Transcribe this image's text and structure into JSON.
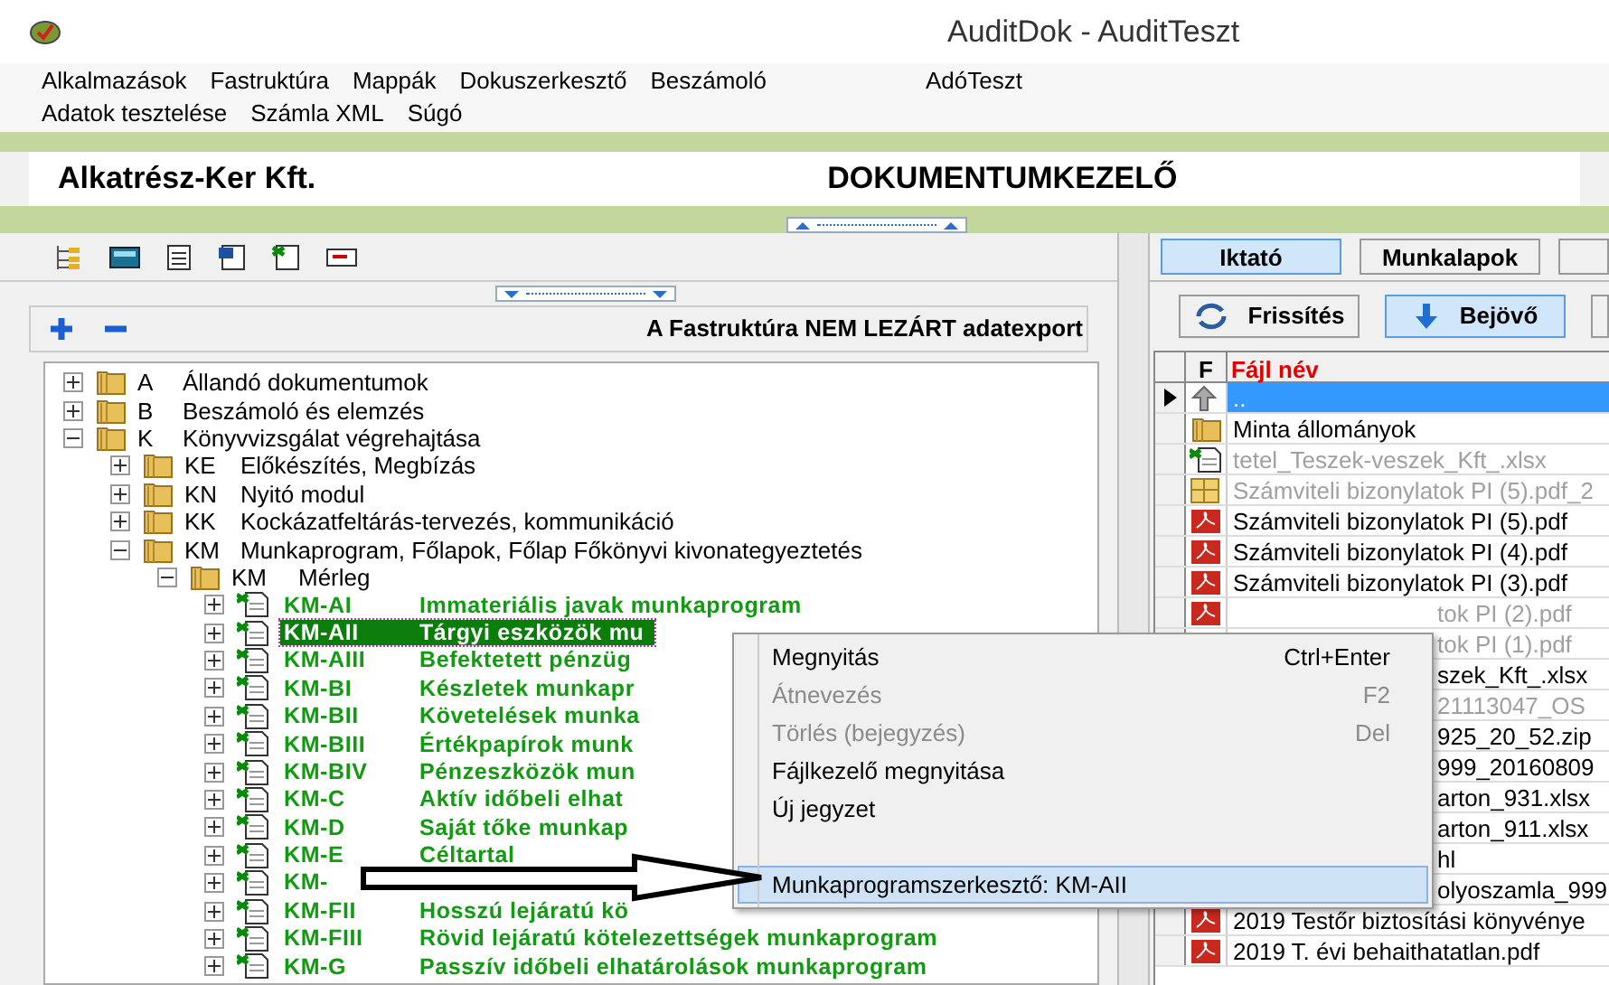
{
  "window": {
    "title": "AuditDok - AuditTeszt"
  },
  "menu_bar": {
    "rows": [
      [
        "Alkalmazások",
        "Fastruktúra",
        "Mappák",
        "Dokuszerkesztő",
        "Beszámoló",
        "AdóTeszt"
      ],
      [
        "Adatok tesztelése",
        "Számla XML",
        "Súgó"
      ]
    ]
  },
  "header": {
    "company": "Alkatrész-Ker Kft.",
    "module": "DOKUMENTUMKEZELŐ"
  },
  "tree_toolbar": {
    "label": "A Fastruktúra NEM LEZÁRT adatexport"
  },
  "tree": [
    {
      "kind": "folder",
      "code": "A",
      "label": "Állandó dokumentumok",
      "expanded": false
    },
    {
      "kind": "folder",
      "code": "B",
      "label": "Beszámoló és elemzés",
      "expanded": false
    },
    {
      "kind": "folder",
      "code": "K",
      "label": "Könyvvizsgálat végrehajtása",
      "expanded": true,
      "children": [
        {
          "kind": "folder",
          "code": "KE",
          "label": "Előkészítés, Megbízás",
          "expanded": false
        },
        {
          "kind": "folder",
          "code": "KN",
          "label": "Nyitó modul",
          "expanded": false
        },
        {
          "kind": "folder",
          "code": "KK",
          "label": "Kockázatfeltárás-tervezés, kommunikáció",
          "expanded": false
        },
        {
          "kind": "folder",
          "code": "KM",
          "label": "Munkaprogram, Főlapok, Főlap Főkönyvi kivonategyeztetés",
          "expanded": true,
          "children": [
            {
              "kind": "folder",
              "code": "KM",
              "label": "Mérleg",
              "expanded": true,
              "children": [
                {
                  "kind": "doc",
                  "code": "KM-AI",
                  "label": "Immateriális javak munkaprogram",
                  "expanded": false,
                  "selected": false
                },
                {
                  "kind": "doc",
                  "code": "KM-AII",
                  "label": "Tárgyi eszközök mu",
                  "expanded": false,
                  "selected": true
                },
                {
                  "kind": "doc",
                  "code": "KM-AIII",
                  "label": "Befektetett pénzüg",
                  "expanded": false,
                  "selected": false
                },
                {
                  "kind": "doc",
                  "code": "KM-BI",
                  "label": "Készletek munkapr",
                  "expanded": false,
                  "selected": false
                },
                {
                  "kind": "doc",
                  "code": "KM-BII",
                  "label": "Követelések munka",
                  "expanded": false,
                  "selected": false
                },
                {
                  "kind": "doc",
                  "code": "KM-BIII",
                  "label": "Értékpapírok munk",
                  "expanded": false,
                  "selected": false
                },
                {
                  "kind": "doc",
                  "code": "KM-BIV",
                  "label": "Pénzeszközök mun",
                  "expanded": false,
                  "selected": false
                },
                {
                  "kind": "doc",
                  "code": "KM-C",
                  "label": "Aktív időbeli elhat",
                  "expanded": false,
                  "selected": false
                },
                {
                  "kind": "doc",
                  "code": "KM-D",
                  "label": "Saját tőke munkap",
                  "expanded": false,
                  "selected": false
                },
                {
                  "kind": "doc",
                  "code": "KM-E",
                  "label": "Céltartal",
                  "expanded": false,
                  "selected": false
                },
                {
                  "kind": "doc",
                  "code": "KM-",
                  "expanded": false,
                  "selected": false
                },
                {
                  "kind": "doc",
                  "code": "KM-FII",
                  "label": "Hosszú lejáratú kö",
                  "expanded": false,
                  "selected": false
                },
                {
                  "kind": "doc",
                  "code": "KM-FIII",
                  "label": "Rövid lejáratú kötelezettségek munkaprogram",
                  "expanded": false,
                  "selected": false
                },
                {
                  "kind": "doc",
                  "code": "KM-G",
                  "label": "Passzív időbeli elhatárolások munkaprogram",
                  "expanded": false,
                  "selected": false
                }
              ]
            }
          ]
        }
      ]
    }
  ],
  "right_tabs": [
    {
      "label": "Iktató",
      "selected": true
    },
    {
      "label": "Munkalapok",
      "selected": false
    }
  ],
  "right_buttons": [
    {
      "kind": "refresh",
      "label": "Frissítés",
      "selected": false
    },
    {
      "kind": "incoming",
      "label": "Bejövő",
      "selected": true
    }
  ],
  "file_grid": {
    "columns": [
      "F",
      "Fájl név"
    ],
    "rows": [
      {
        "kind": "up",
        "name": "..",
        "dimmed": false,
        "selected": true,
        "covered": false
      },
      {
        "kind": "folder",
        "name": "Minta állományok",
        "dimmed": false,
        "selected": false,
        "covered": false
      },
      {
        "kind": "excel",
        "name": "tetel_Teszek-veszek_Kft_.xlsx",
        "dimmed": true,
        "selected": false,
        "covered": false
      },
      {
        "kind": "archive",
        "name": "Számviteli bizonylatok PI (5).pdf_2",
        "dimmed": true,
        "selected": false,
        "covered": false
      },
      {
        "kind": "pdf",
        "name": "Számviteli bizonylatok PI (5).pdf",
        "dimmed": false,
        "selected": false,
        "covered": false
      },
      {
        "kind": "pdf",
        "name": "Számviteli bizonylatok PI (4).pdf",
        "dimmed": false,
        "selected": false,
        "covered": false
      },
      {
        "kind": "pdf",
        "name": "Számviteli bizonylatok PI (3).pdf",
        "dimmed": false,
        "selected": false,
        "covered": false
      },
      {
        "kind": "pdf",
        "name": "tok PI (2).pdf",
        "dimmed": true,
        "selected": false,
        "covered": true
      },
      {
        "kind": "none",
        "name": "tok PI (1).pdf",
        "dimmed": true,
        "selected": false,
        "covered": true
      },
      {
        "kind": "none",
        "name": "szek_Kft_.xlsx",
        "dimmed": false,
        "selected": false,
        "covered": true
      },
      {
        "kind": "none",
        "name": "21113047_OS",
        "dimmed": true,
        "selected": false,
        "covered": true
      },
      {
        "kind": "none",
        "name": "925_20_52.zip",
        "dimmed": false,
        "selected": false,
        "covered": true
      },
      {
        "kind": "none",
        "name": "999_20160809",
        "dimmed": false,
        "selected": false,
        "covered": true
      },
      {
        "kind": "none",
        "name": "arton_931.xlsx",
        "dimmed": false,
        "selected": false,
        "covered": true
      },
      {
        "kind": "none",
        "name": "arton_911.xlsx",
        "dimmed": false,
        "selected": false,
        "covered": true
      },
      {
        "kind": "none",
        "name": "hl",
        "dimmed": false,
        "selected": false,
        "covered": true
      },
      {
        "kind": "none",
        "name": "olyoszamla_999",
        "dimmed": false,
        "selected": false,
        "covered": true
      },
      {
        "kind": "pdf",
        "name": "2019 Testőr biztosítási könyvénye",
        "dimmed": false,
        "selected": false,
        "covered": false
      },
      {
        "kind": "pdf",
        "name": "2019 T. évi behaithatatlan.pdf",
        "dimmed": false,
        "selected": false,
        "covered": false
      }
    ]
  },
  "context_menu": [
    {
      "kind": "item",
      "label": "Megnyitás",
      "shortcut": "Ctrl+Enter",
      "disabled": false,
      "selected": false
    },
    {
      "kind": "item",
      "label": "Átnevezés",
      "shortcut": "F2",
      "disabled": true,
      "selected": false
    },
    {
      "kind": "item",
      "label": "Törlés (bejegyzés)",
      "shortcut": "Del",
      "disabled": true,
      "selected": false
    },
    {
      "kind": "item",
      "label": "Fájlkezelő megnyitása",
      "disabled": false,
      "selected": false
    },
    {
      "kind": "item",
      "label": "Új jegyzet",
      "disabled": false,
      "selected": false
    },
    {
      "kind": "spacer"
    },
    {
      "kind": "item",
      "label": "Munkaprogramszerkesztő: KM-AII",
      "disabled": false,
      "selected": true
    }
  ]
}
